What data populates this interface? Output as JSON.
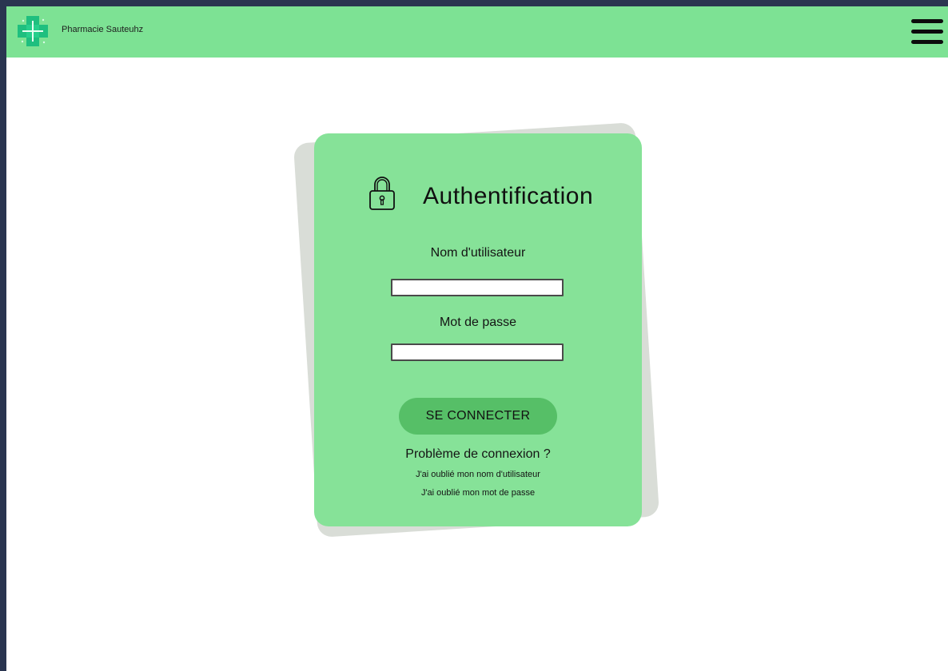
{
  "header": {
    "brand": "Pharmacie Sauteuhz",
    "logo_icon": "pharmacy-cross-icon",
    "menu_icon": "hamburger-menu-icon",
    "background_color": "#7de294"
  },
  "login": {
    "title": "Authentification",
    "title_icon": "padlock-icon",
    "username_label": "Nom d'utilisateur",
    "username_value": "",
    "password_label": "Mot de passe",
    "password_value": "",
    "submit_label": "SE CONNECTER",
    "help_title": "Problème de connexion ?",
    "forgot_username": "J'ai oublié mon nom d'utilisateur",
    "forgot_password": "J'ai oublié mon mot de passe",
    "card_color": "#86e298",
    "button_color": "#56bf67"
  }
}
